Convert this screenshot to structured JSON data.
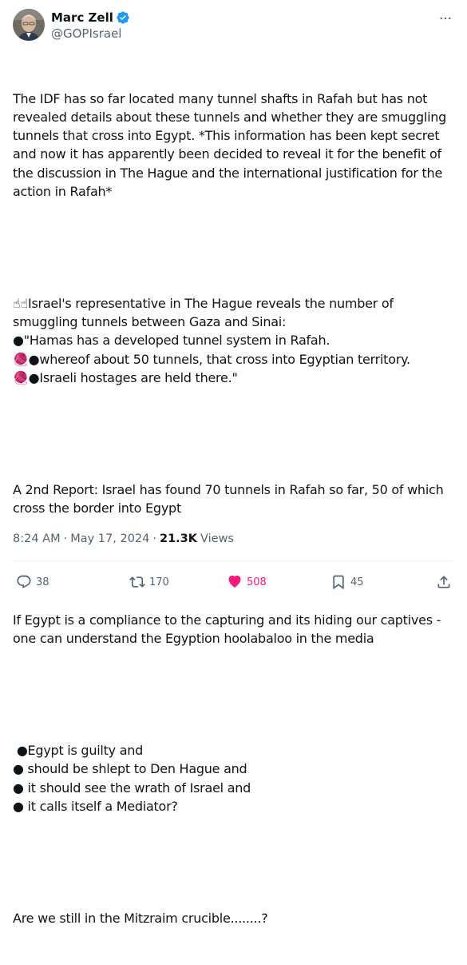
{
  "author": {
    "display_name": "Marc Zell",
    "handle": "@GOPIsrael",
    "verified": true
  },
  "tweet": {
    "paragraphs": [
      "The IDF has so far located many tunnel shafts in Rafah but has not revealed details about these tunnels and whether they are smuggling tunnels that cross into Egypt. *This information has been kept secret and now it has apparently been decided to reveal it for the benefit of the discussion in The Hague and the international justification for the action in Rafah*",
      "☝☝Israel's representative in The Hague reveals the number of smuggling tunnels between Gaza and Sinai:\n●\"Hamas has a developed tunnel system in Rafah.\n🧶●whereof about 50 tunnels, that cross into Egyptian territory.\n🧶●Israeli hostages are held there.\"",
      "A 2nd Report: Israel has found 70 tunnels in Rafah so far, 50 of which cross the border into Egypt",
      "If Egypt is a compliance to the capturing and its hiding our captives - one can understand the Egyption hoolabaloo in the media",
      " ●Egypt is guilty and\n● should be shlept to Den Hague and\n● it should see the wrath of Israel and\n● it calls itself a Mediator?",
      "Are we still in the Mitzraim crucible........?"
    ],
    "time": "8:24 AM",
    "date": "May 17, 2024",
    "views_count": "21.3K",
    "views_label": "Views"
  },
  "actions": {
    "replies": "38",
    "reposts": "170",
    "likes": "508",
    "bookmarks": "45"
  },
  "icons": {
    "more": "more-horizontal-icon",
    "verified": "verified-badge-icon",
    "reply": "reply-icon",
    "repost": "repost-icon",
    "like": "heart-icon",
    "bookmark": "bookmark-icon",
    "share": "share-icon"
  },
  "colors": {
    "text": "#0f1419",
    "secondary": "#536471",
    "verified": "#1d9bf0",
    "like": "#f91880",
    "divider": "#eff3f4"
  }
}
